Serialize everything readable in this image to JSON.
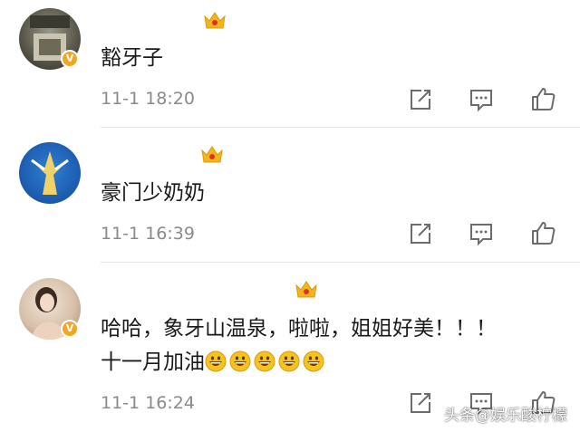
{
  "comments": [
    {
      "avatar": "avatar-photo",
      "verified_icon": "verified-v-icon",
      "badge_icon": "crown-badge-icon",
      "text": "豁牙子",
      "time": "11-1 18:20"
    },
    {
      "avatar": "avatar-photo",
      "verified_icon": "",
      "badge_icon": "crown-badge-icon",
      "text": "豪门少奶奶",
      "time": "11-1 16:39"
    },
    {
      "avatar": "avatar-photo",
      "verified_icon": "verified-v-icon",
      "badge_icon": "crown-badge-icon",
      "text_line1": "哈哈，象牙山温泉，啦啦，姐姐好美！！！",
      "text_line2": "十一月加油",
      "emoji_icon": "grinning-face-icon",
      "emoji_count": 5,
      "time": "11-1 16:24"
    }
  ],
  "actions": {
    "share_icon": "share-icon",
    "reply_icon": "comment-icon",
    "like_icon": "thumbs-up-icon"
  },
  "verified_mark": "V",
  "watermark": "头条@娱乐酸柠檬",
  "colors": {
    "verified": "#f0a821",
    "crown": "#f2b619",
    "crown_gem": "#e0302c",
    "time": "#8a8a8a",
    "emoji": "#f6c21c"
  }
}
